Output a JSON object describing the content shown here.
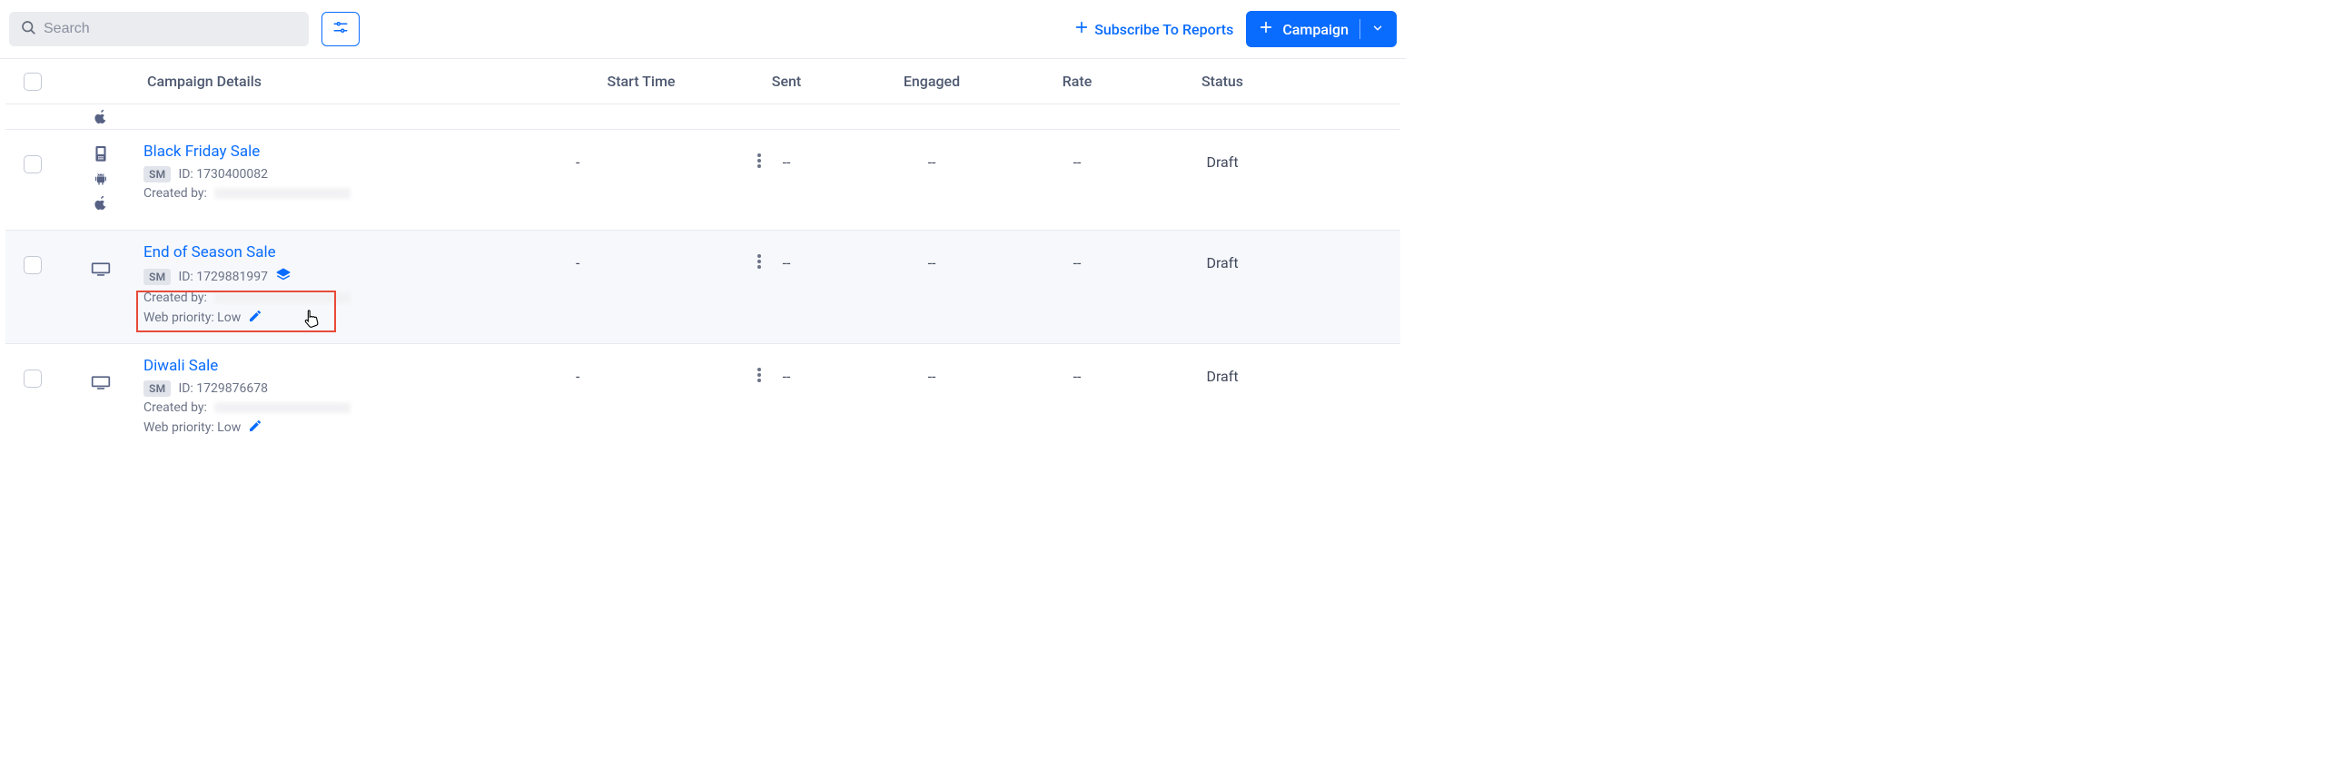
{
  "toolbar": {
    "search_placeholder": "Search",
    "subscribe_label": "Subscribe To Reports",
    "campaign_label": "Campaign"
  },
  "columns": {
    "details": "Campaign Details",
    "start": "Start Time",
    "sent": "Sent",
    "engaged": "Engaged",
    "rate": "Rate",
    "status": "Status"
  },
  "rows": [
    {
      "name": "Black Friday Sale",
      "chip": "SM",
      "id_label": "ID: 1730400082",
      "created_by_label": "Created by:",
      "start": "-",
      "sent": "--",
      "engaged": "--",
      "rate": "--",
      "status": "Draft"
    },
    {
      "name": "End of Season Sale",
      "chip": "SM",
      "id_label": "ID: 1729881997",
      "created_by_label": "Created by:",
      "priority_label": "Web priority: Low",
      "start": "-",
      "sent": "--",
      "engaged": "--",
      "rate": "--",
      "status": "Draft"
    },
    {
      "name": "Diwali Sale",
      "chip": "SM",
      "id_label": "ID: 1729876678",
      "created_by_label": "Created by:",
      "priority_label": "Web priority: Low",
      "start": "-",
      "sent": "--",
      "engaged": "--",
      "rate": "--",
      "status": "Draft"
    }
  ]
}
